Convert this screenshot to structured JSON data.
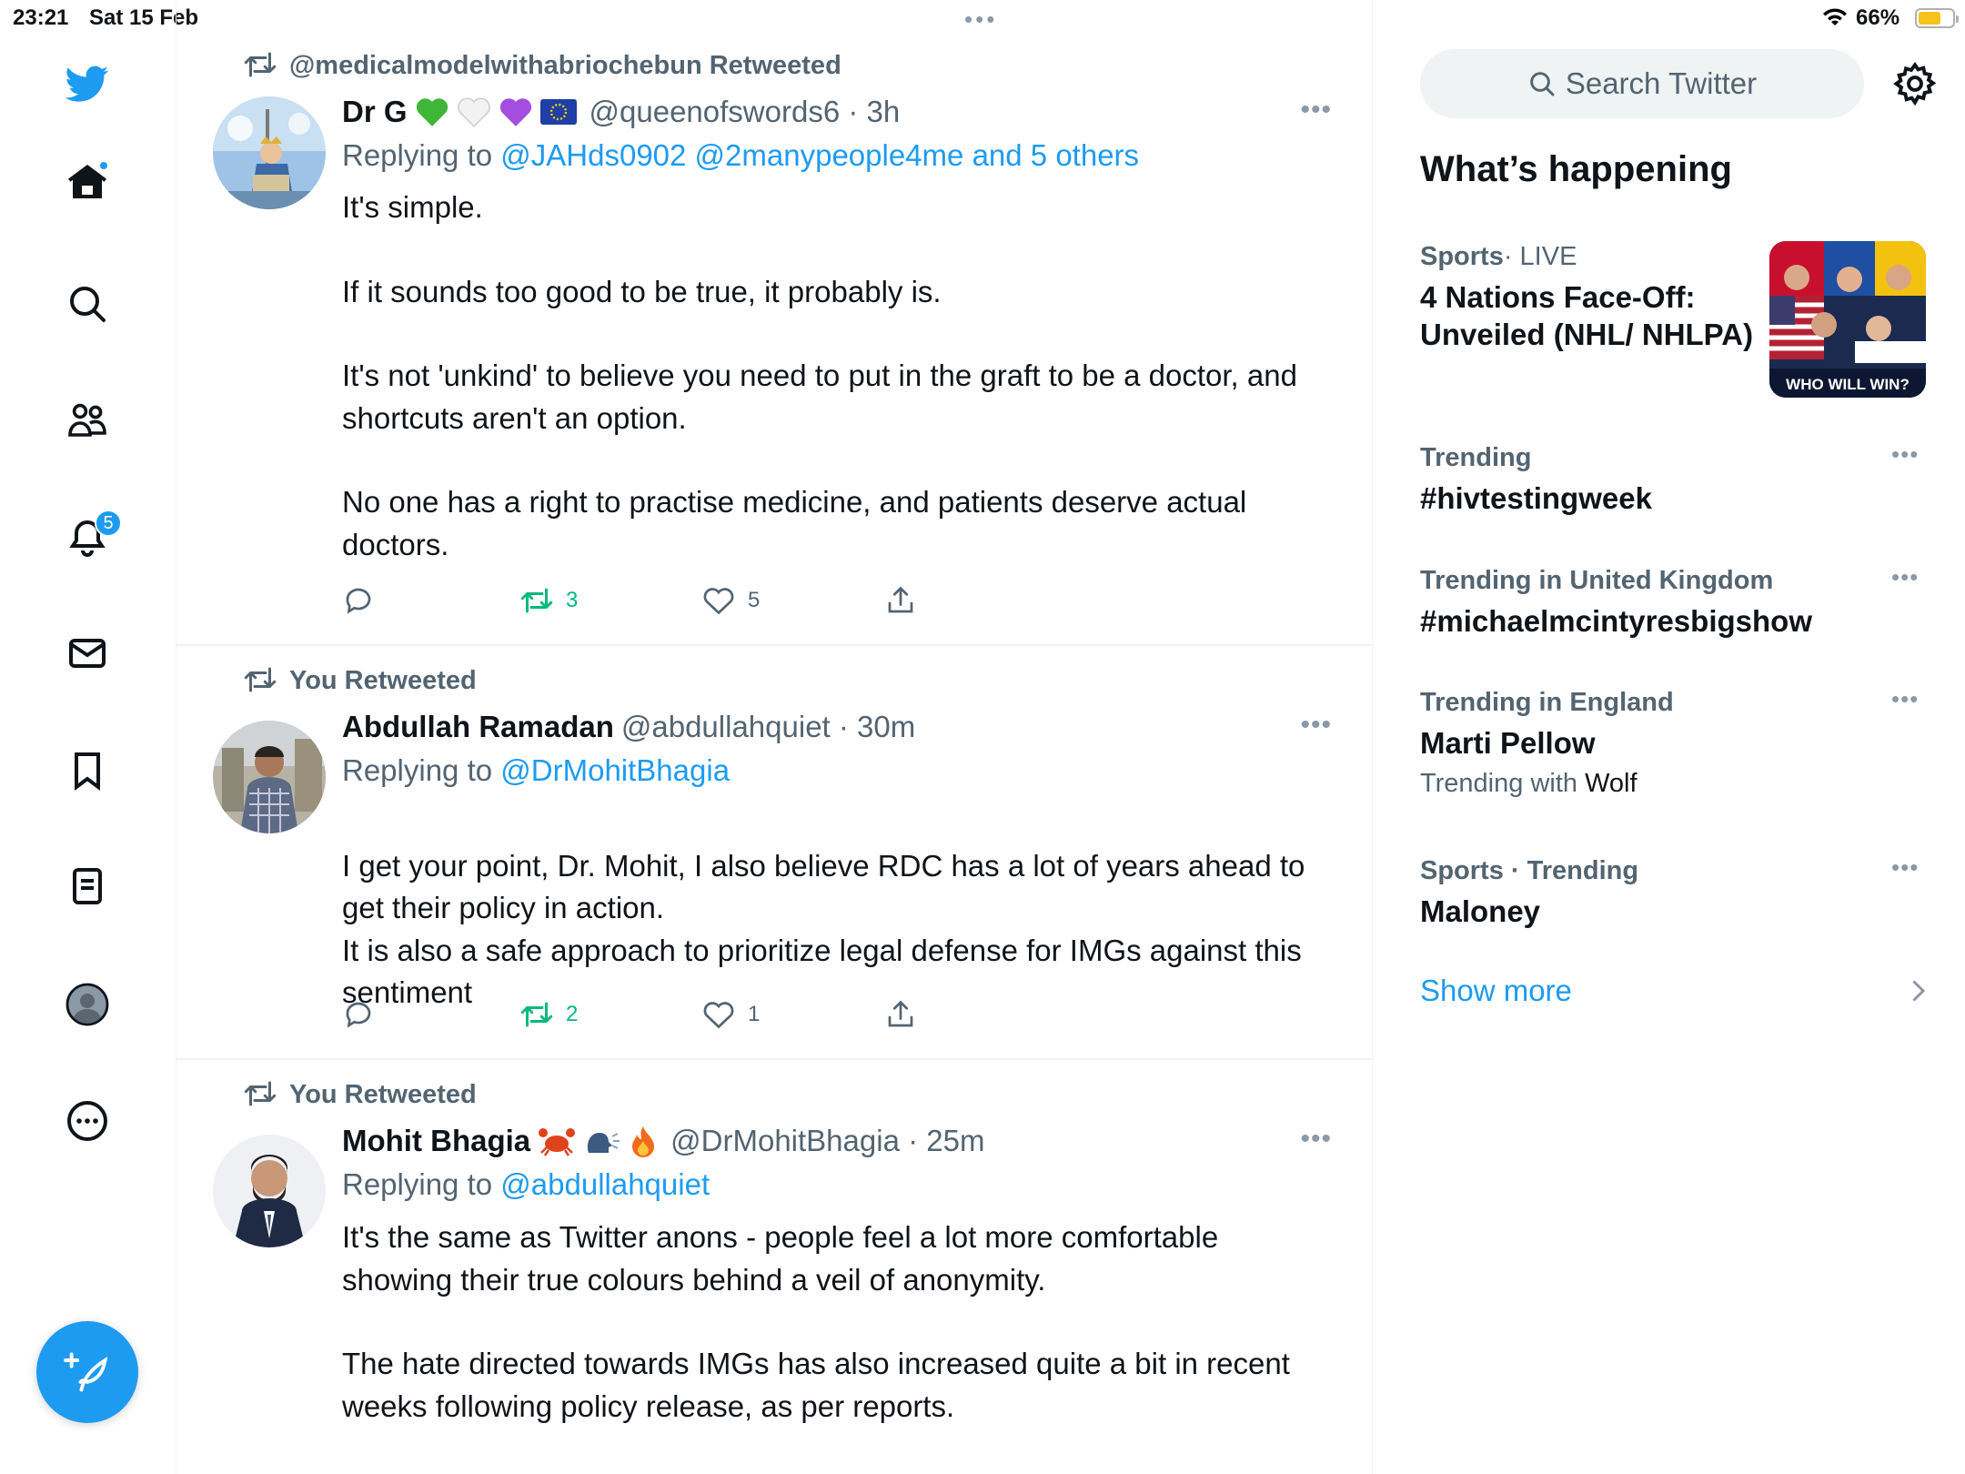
{
  "status_bar": {
    "time": "23:21",
    "date": "Sat 15 Feb",
    "dots": "•••",
    "battery_pct": "66%",
    "battery_level": 0.66,
    "battery_color": "#f7c21b"
  },
  "nav": {
    "notifications_badge": "5",
    "items": [
      "twitter-logo",
      "home-icon",
      "search-icon",
      "people-icon",
      "bell-icon",
      "mail-icon",
      "bookmark-icon",
      "lists-icon",
      "profile-icon",
      "more-icon"
    ],
    "compose_icon": "feather-plus-icon"
  },
  "tweets": [
    {
      "retweeted_by": "@medicalmodelwithabriochebun Retweeted",
      "name": "Dr G",
      "emojis": [
        "💚",
        "🤍",
        "💜",
        "🇪🇺"
      ],
      "handle": "@queenofswords6",
      "time": "3h",
      "replying_to_prefix": "Replying to",
      "replying_to": "@JAHds0902 @2manypeople4me and 5 others",
      "body": [
        "It's simple.",
        "If it sounds too good to be true, it probably is.",
        "It's not 'unkind' to believe you need to put in the graft to be a doctor, and shortcuts aren't an option.",
        "No one has a right to practise medicine, and patients deserve actual doctors."
      ],
      "retweets": "3",
      "likes": "5"
    },
    {
      "retweeted_by": "You Retweeted",
      "name": "Abdullah Ramadan",
      "emojis": [],
      "handle": "@abdullahquiet",
      "time": "30m",
      "replying_to_prefix": "Replying to",
      "replying_to": "@DrMohitBhagia",
      "body": [
        "I get your point, Dr. Mohit, I also believe RDC has a lot of years ahead to get their policy in action.\nIt is also a safe approach to prioritize legal defense for IMGs against this sentiment"
      ],
      "retweets": "2",
      "likes": "1"
    },
    {
      "retweeted_by": "You Retweeted",
      "name": "Mohit Bhagia",
      "emojis": [
        "🦀",
        "🗣️",
        "🔥"
      ],
      "handle": "@DrMohitBhagia",
      "time": "25m",
      "replying_to_prefix": "Replying to",
      "replying_to": "@abdullahquiet",
      "body": [
        "It's the same as Twitter anons - people feel a lot more comfortable showing their true colours behind a veil of anonymity.",
        "The hate directed towards IMGs has also increased quite a bit in recent weeks following policy release, as per reports."
      ]
    }
  ],
  "sidebar": {
    "search_placeholder": "Search Twitter",
    "whats_happening": "What’s happening",
    "trends": [
      {
        "meta_bold": "Sports",
        "meta_light": " · LIVE",
        "title": "4 Nations Face-Off: Unveiled (NHL/ NHLPA)",
        "image_caption": "WHO WILL WIN?"
      },
      {
        "meta_bold": "Trending",
        "meta_light": "",
        "title": "#hivtestingweek"
      },
      {
        "meta_bold": "Trending in United Kingdom",
        "meta_light": "",
        "title": "#michaelmcintyresbigshow"
      },
      {
        "meta_bold": "Trending in England",
        "meta_light": "",
        "title": "Marti Pellow",
        "sub_prefix": "Trending with ",
        "sub_name": "Wolf"
      },
      {
        "meta_bold": "Sports · Trending",
        "meta_light": "",
        "title": "Maloney"
      }
    ],
    "show_more": "Show more",
    "accent": "#1d9bf0"
  }
}
